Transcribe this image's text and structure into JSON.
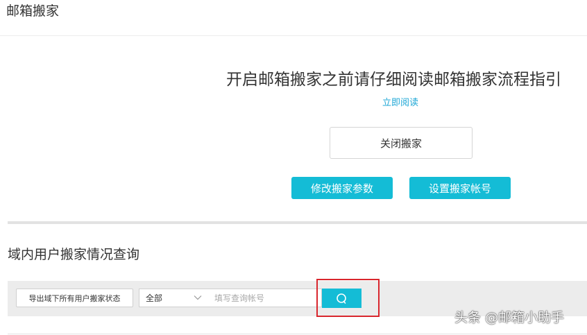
{
  "header": {
    "title": "邮箱搬家"
  },
  "guide": {
    "heading": "开启邮箱搬家之前请仔细阅读邮箱搬家流程指引",
    "read_link": "立即阅读"
  },
  "actions": {
    "close_label": "关闭搬家",
    "modify_label": "修改搬家参数",
    "set_account_label": "设置搬家帐号"
  },
  "query": {
    "section_title": "域内用户搬家情况查询",
    "export_label": "导出域下所有用户搬家状态",
    "scope_value": "全部",
    "account_placeholder": "填写查询帐号",
    "account_value": ""
  },
  "watermark": {
    "text": "头条 @邮箱小助手"
  },
  "colors": {
    "accent": "#14bcd6",
    "link": "#1ea7d6",
    "highlight": "#d9262d"
  },
  "icons": {
    "search": "search-icon",
    "dropdown": "chevron-down-icon"
  }
}
